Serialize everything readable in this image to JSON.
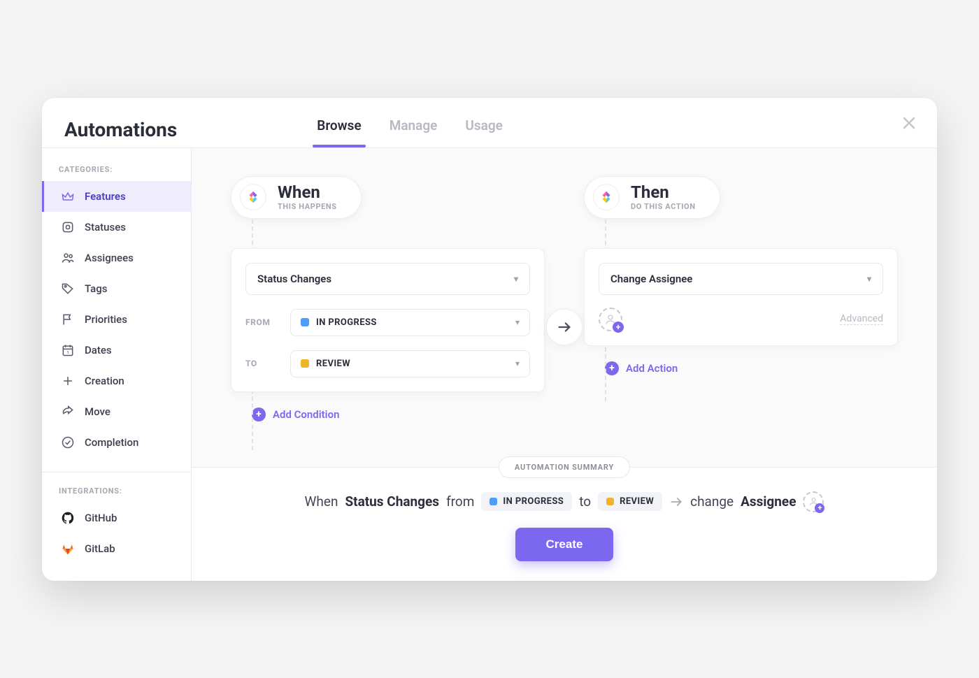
{
  "header": {
    "title": "Automations",
    "tabs": [
      {
        "label": "Browse",
        "active": true
      },
      {
        "label": "Manage",
        "active": false
      },
      {
        "label": "Usage",
        "active": false
      }
    ]
  },
  "sidebar": {
    "section1_label": "CATEGORIES:",
    "section2_label": "INTEGRATIONS:",
    "categories": [
      {
        "label": "Features",
        "icon": "crown",
        "active": true
      },
      {
        "label": "Statuses",
        "icon": "status",
        "active": false
      },
      {
        "label": "Assignees",
        "icon": "people",
        "active": false
      },
      {
        "label": "Tags",
        "icon": "tag",
        "active": false
      },
      {
        "label": "Priorities",
        "icon": "flag",
        "active": false
      },
      {
        "label": "Dates",
        "icon": "calendar",
        "active": false
      },
      {
        "label": "Creation",
        "icon": "plus",
        "active": false
      },
      {
        "label": "Move",
        "icon": "share",
        "active": false
      },
      {
        "label": "Completion",
        "icon": "check",
        "active": false
      }
    ],
    "integrations": [
      {
        "label": "GitHub",
        "icon": "github"
      },
      {
        "label": "GitLab",
        "icon": "gitlab"
      }
    ]
  },
  "when": {
    "title": "When",
    "sub": "THIS HAPPENS",
    "trigger": "Status Changes",
    "from_label": "FROM",
    "from_status": "IN PROGRESS",
    "from_color": "#4f9cf9",
    "to_label": "TO",
    "to_status": "REVIEW",
    "to_color": "#f0b429",
    "add_condition": "Add Condition"
  },
  "then": {
    "title": "Then",
    "sub": "DO THIS ACTION",
    "action": "Change Assignee",
    "advanced": "Advanced",
    "add_action": "Add Action"
  },
  "summary": {
    "badge": "AUTOMATION SUMMARY",
    "word_when": "When",
    "word_status_changes": "Status Changes",
    "word_from": "from",
    "word_to": "to",
    "word_change": "change",
    "word_assignee": "Assignee"
  },
  "create_label": "Create"
}
